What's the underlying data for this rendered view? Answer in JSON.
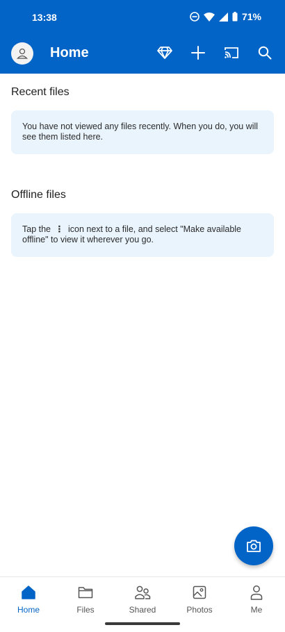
{
  "status_bar": {
    "time": "13:38",
    "battery": "71%"
  },
  "app_bar": {
    "title": "Home",
    "icons": [
      "avatar",
      "premium-diamond-icon",
      "add-icon",
      "cast-icon",
      "search-icon"
    ]
  },
  "sections": {
    "recent": {
      "title": "Recent files",
      "message": "You have not viewed any files recently. When you do, you will see them listed here."
    },
    "offline": {
      "title": "Offline files",
      "message_before": "Tap the",
      "message_icon": "⋮",
      "message_after": "icon next to a file, and select \"Make available offline\" to view it wherever you go."
    }
  },
  "fab": {
    "icon": "camera-icon"
  },
  "bottom_nav": {
    "active": "Home",
    "items": [
      {
        "label": "Home"
      },
      {
        "label": "Files"
      },
      {
        "label": "Shared"
      },
      {
        "label": "Photos"
      },
      {
        "label": "Me"
      }
    ]
  },
  "colors": {
    "primary": "#0364c8",
    "card_background": "#e9f4fd"
  }
}
